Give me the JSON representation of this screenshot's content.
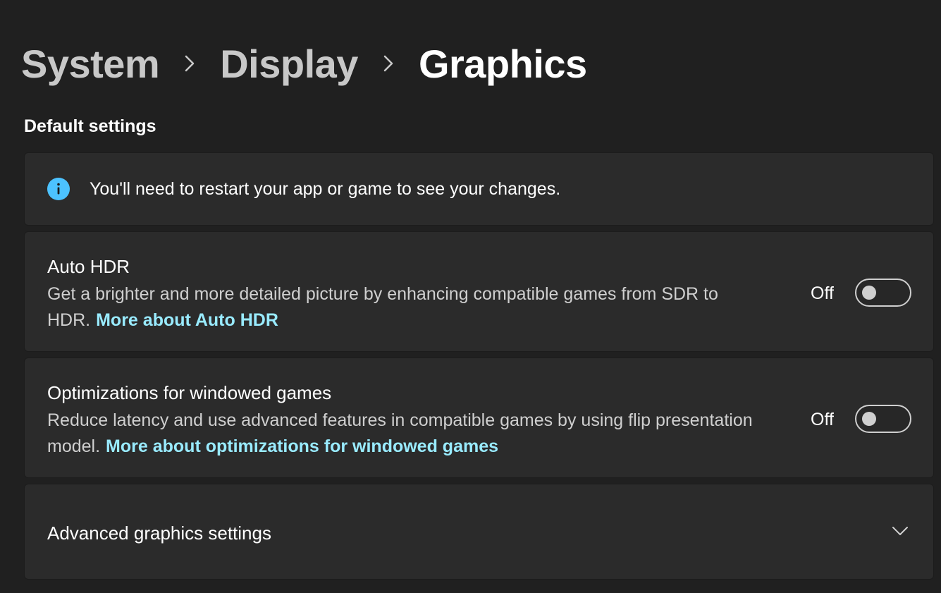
{
  "breadcrumb": {
    "items": [
      {
        "label": "System"
      },
      {
        "label": "Display"
      },
      {
        "label": "Graphics"
      }
    ],
    "separator_icon": "chevron-right-icon"
  },
  "section": {
    "title": "Default settings"
  },
  "info_banner": {
    "icon": "info-icon",
    "text": "You'll need to restart your app or game to see your changes.",
    "icon_color": "#4cc2ff"
  },
  "settings": [
    {
      "title": "Auto HDR",
      "description": "Get a brighter and more detailed picture by enhancing compatible games from SDR to HDR.",
      "link_text": "More about Auto HDR",
      "state_label": "Off",
      "enabled": false
    },
    {
      "title": "Optimizations for windowed games",
      "description": "Reduce latency and use advanced features in compatible games by using flip presentation model.",
      "link_text": "More about optimizations for windowed games",
      "state_label": "Off",
      "enabled": false
    }
  ],
  "advanced": {
    "title": "Advanced graphics settings",
    "icon": "chevron-down-icon"
  },
  "colors": {
    "background": "#202020",
    "card": "#2b2b2b",
    "link": "#99ebff",
    "accent": "#4cc2ff"
  }
}
